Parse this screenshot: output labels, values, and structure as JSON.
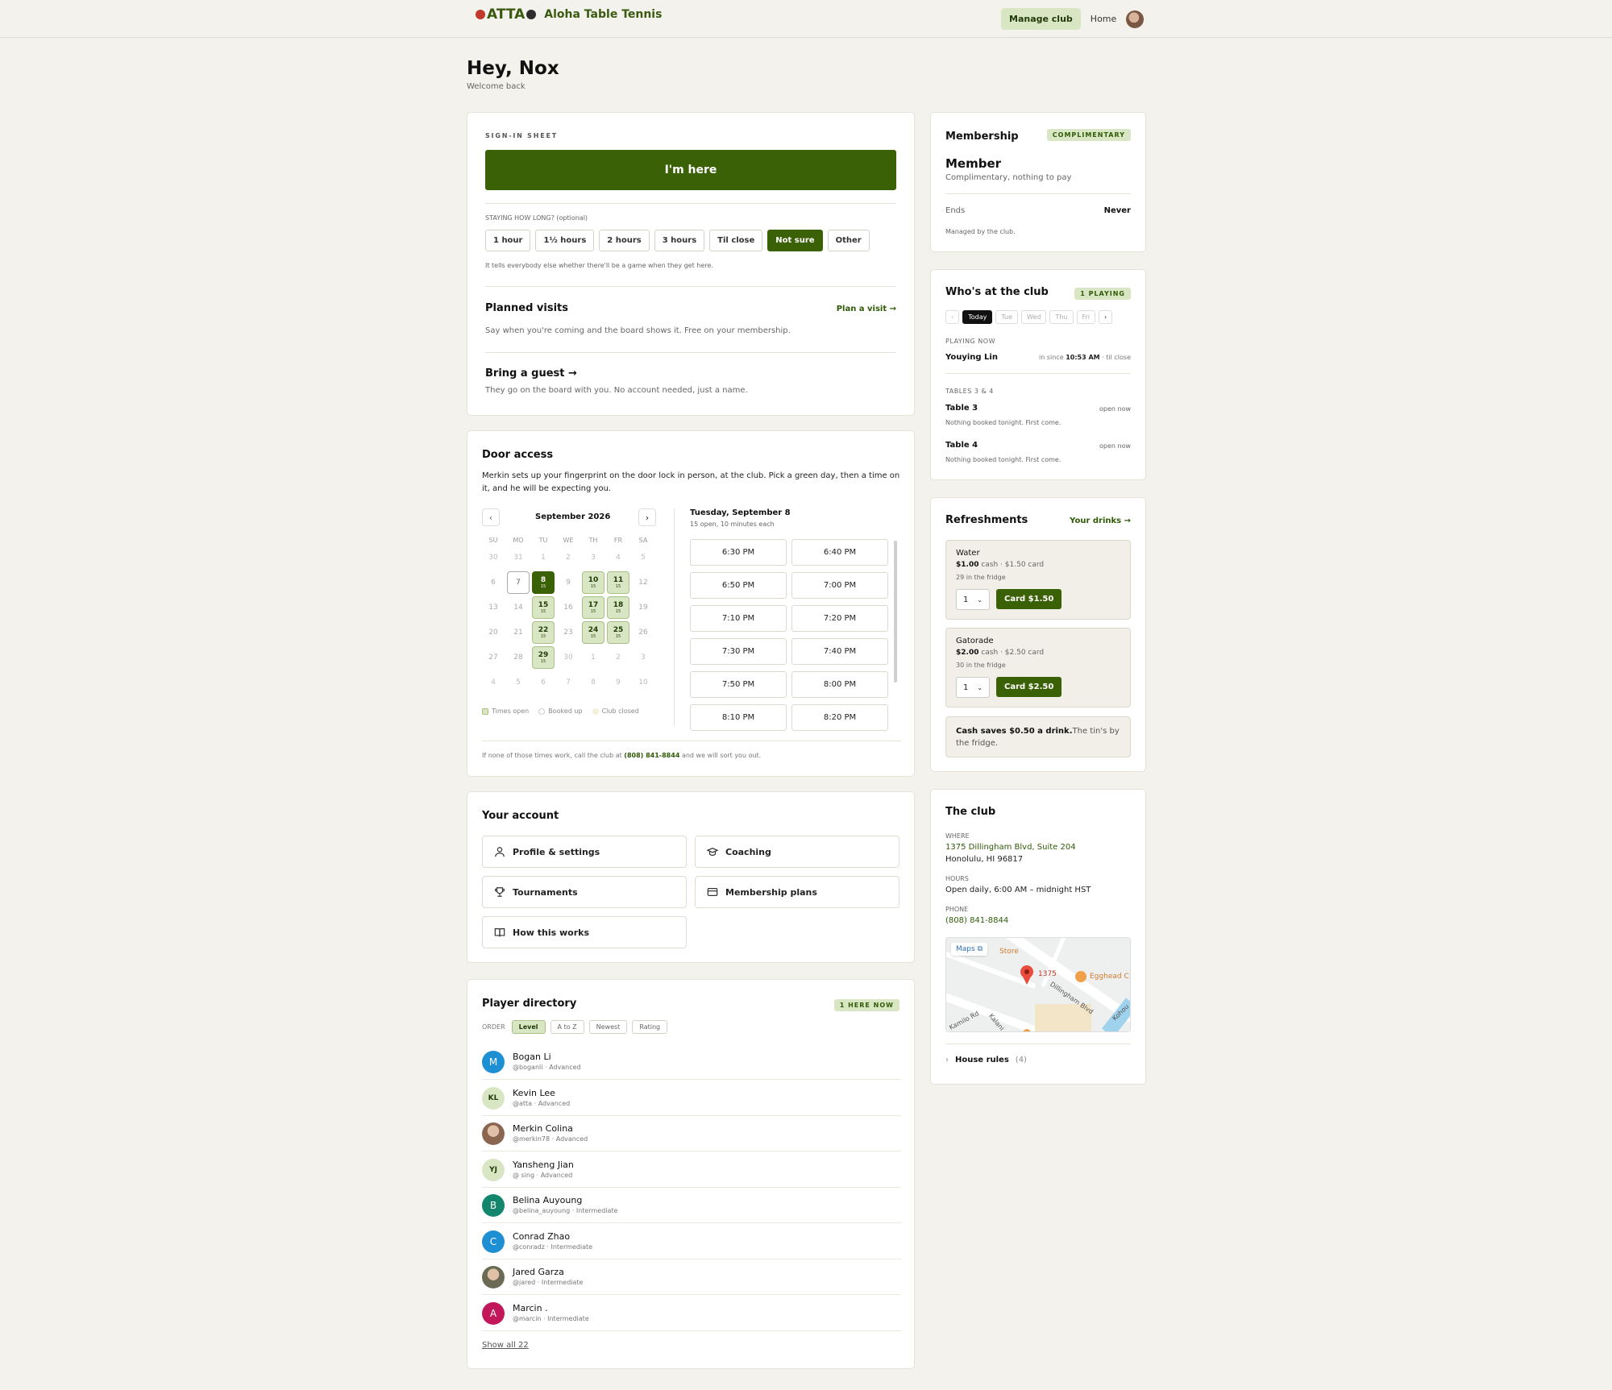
{
  "app": {
    "name": "Aloha Table Tennis",
    "logo_text": "ATTA"
  },
  "nav": {
    "manage": "Manage club",
    "home": "Home"
  },
  "greeting": {
    "title": "Hey, Nox",
    "subtitle": "Welcome back"
  },
  "signin": {
    "label": "SIGN-IN SHEET",
    "button": "I'm here",
    "duration_label": "STAYING HOW LONG? (optional)",
    "durations": [
      "1 hour",
      "1½ hours",
      "2 hours",
      "3 hours",
      "Til close",
      "Not sure",
      "Other"
    ],
    "selected_duration": "Not sure",
    "duration_help": "It tells everybody else whether there'll be a game when they get here.",
    "planned_title": "Planned visits",
    "planned_link": "Plan a visit →",
    "planned_desc": "Say when you're coming and the board shows it. Free on your membership.",
    "guest_title": "Bring a guest →",
    "guest_desc": "They go on the board with you. No account needed, just a name."
  },
  "door": {
    "title": "Door access",
    "desc": "Merkin sets up your fingerprint on the door lock in person, at the club. Pick a green day, then a time on it, and he will be expecting you.",
    "month": "September 2026",
    "weekdays": [
      "SU",
      "MO",
      "TU",
      "WE",
      "TH",
      "FR",
      "SA"
    ],
    "weeks": [
      [
        "30",
        "31",
        "1",
        "2",
        "3",
        "4",
        "5"
      ],
      [
        "6",
        "7",
        "8",
        "9",
        "10",
        "11",
        "12"
      ],
      [
        "13",
        "14",
        "15",
        "16",
        "17",
        "18",
        "19"
      ],
      [
        "20",
        "21",
        "22",
        "23",
        "24",
        "25",
        "26"
      ],
      [
        "27",
        "28",
        "29",
        "30",
        "1",
        "2",
        "3"
      ],
      [
        "4",
        "5",
        "6",
        "7",
        "8",
        "9",
        "10"
      ]
    ],
    "open_sub": "15",
    "legend": [
      "Times open",
      "Booked up",
      "Club closed"
    ],
    "selected_date": "Tuesday, September 8",
    "slots_sub": "15 open, 10 minutes each",
    "slots": [
      "6:30 PM",
      "6:40 PM",
      "6:50 PM",
      "7:00 PM",
      "7:10 PM",
      "7:20 PM",
      "7:30 PM",
      "7:40 PM",
      "7:50 PM",
      "8:00 PM",
      "8:10 PM",
      "8:20 PM"
    ],
    "footer_pre": "If none of those times work, call the club at",
    "footer_phone": "(808) 841-8844",
    "footer_post": "and we will sort you out."
  },
  "account": {
    "title": "Your account",
    "items": [
      "Profile & settings",
      "Coaching",
      "Tournaments",
      "Membership plans",
      "How this works"
    ]
  },
  "directory": {
    "title": "Player directory",
    "badge": "1 HERE NOW",
    "order_label": "ORDER",
    "orders": [
      "Level",
      "A to Z",
      "Newest",
      "Rating"
    ],
    "players": [
      {
        "initials": "M",
        "name": "Bogan Li",
        "sub": "@boganli · Advanced",
        "color": "#1f8fd3"
      },
      {
        "initials": "KL",
        "name": "Kevin Lee",
        "sub": "@atta · Advanced",
        "color": "#d9e6c4"
      },
      {
        "initials": "",
        "name": "Merkin Colina",
        "sub": "@merkin78 · Advanced",
        "color": "#8a6650"
      },
      {
        "initials": "YJ",
        "name": "Yansheng Jian",
        "sub": "@ sing · Advanced",
        "color": "#d9e6c4"
      },
      {
        "initials": "B",
        "name": "Belina Auyoung",
        "sub": "@belina_auyoung · Intermediate",
        "color": "#14866d"
      },
      {
        "initials": "C",
        "name": "Conrad Zhao",
        "sub": "@conradz · Intermediate",
        "color": "#1f8fd3"
      },
      {
        "initials": "",
        "name": "Jared Garza",
        "sub": "@jared · Intermediate",
        "color": "#6b6b55"
      },
      {
        "initials": "A",
        "name": "Marcin .",
        "sub": "@marcin · Intermediate",
        "color": "#c2185b"
      }
    ],
    "show_all": "Show all 22"
  },
  "membership": {
    "title": "Membership",
    "badge": "COMPLIMENTARY",
    "tier": "Member",
    "tier_desc": "Complimentary, nothing to pay",
    "ends_label": "Ends",
    "ends_value": "Never",
    "managed": "Managed by the club."
  },
  "who": {
    "title": "Who's at the club",
    "badge": "1 PLAYING",
    "days": [
      "Today",
      "Tue",
      "Wed",
      "Thu",
      "Fri"
    ],
    "playing_label": "PLAYING NOW",
    "player": "Youying Lin",
    "since_pre": "in since",
    "since_time": "10:53 AM",
    "since_post": "· til close",
    "tables_label": "TABLES 3 & 4",
    "tables": [
      {
        "name": "Table 3",
        "desc": "Nothing booked tonight. First come.",
        "status": "open now"
      },
      {
        "name": "Table 4",
        "desc": "Nothing booked tonight. First come.",
        "status": "open now"
      }
    ]
  },
  "refresh": {
    "title": "Refreshments",
    "link": "Your drinks →",
    "drinks": [
      {
        "name": "Water",
        "cash": "$1.00",
        "cash_label": "cash",
        "card": "· $1.50 card",
        "stock": "29 in the fridge",
        "qty": "1",
        "button": "Card $1.50"
      },
      {
        "name": "Gatorade",
        "cash": "$2.00",
        "cash_label": "cash",
        "card": "· $2.50 card",
        "stock": "30 in the fridge",
        "qty": "1",
        "button": "Card $2.50"
      }
    ],
    "note_bold": "Cash saves $0.50 a drink.",
    "note_rest": "The tin's by the fridge."
  },
  "club": {
    "title": "The club",
    "where_label": "WHERE",
    "address1": "1375 Dillingham Blvd, Suite 204",
    "address2": "Honolulu, HI 96817",
    "hours_label": "HOURS",
    "hours": "Open daily, 6:00 AM – midnight HST",
    "phone_label": "PHONE",
    "phone": "(808) 841-8844",
    "map_maps": "Maps",
    "map_store": "Store",
    "map_num": "1375",
    "map_place": "Egghead C",
    "map_road1": "Dillingham Blvd",
    "map_road2": "Kamilo Rd",
    "map_road3": "Kohou",
    "map_road4": "Kalani",
    "rules": "House rules",
    "rules_count": "(4)"
  },
  "colors": {
    "brand_green": "#3b6107",
    "soft_green": "#d9e6c4",
    "background": "#f4f2ec"
  }
}
